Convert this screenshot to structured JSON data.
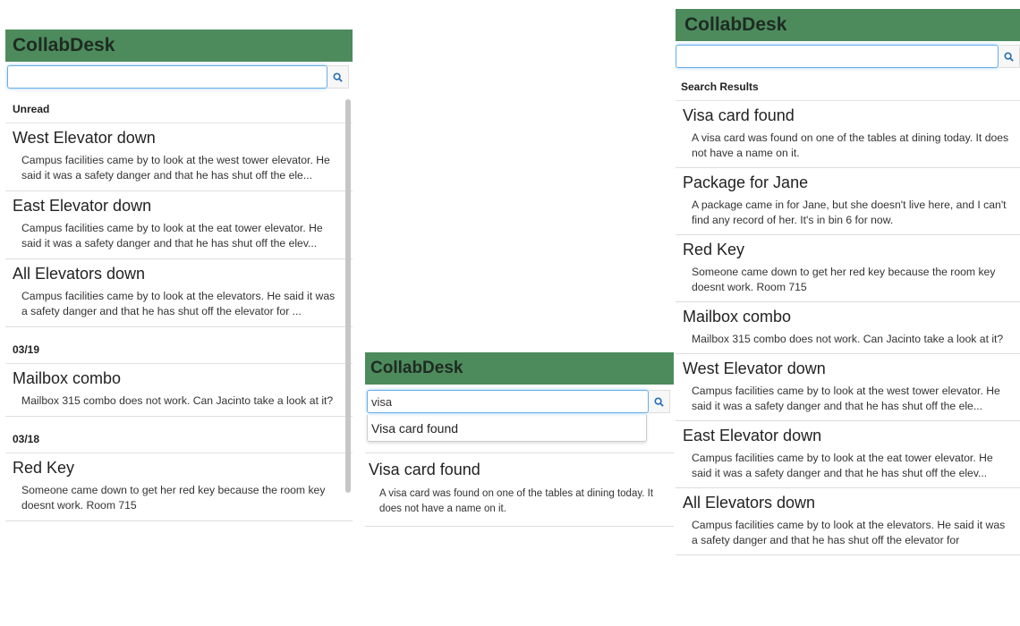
{
  "app": {
    "title": "CollabDesk",
    "header_color": "#4d8b5d"
  },
  "panel_1": {
    "search": {
      "value": "",
      "placeholder": ""
    },
    "sections": [
      {
        "heading": "Unread",
        "items": [
          {
            "title": "West Elevator down",
            "body": "Campus facilities came by to look at the west tower elevator. He said it was a safety danger and that he has shut off the ele..."
          },
          {
            "title": "East Elevator down",
            "body": "Campus facilities came by to look at the eat tower elevator. He said it was a safety danger and that he has shut off the elev..."
          },
          {
            "title": "All Elevators down",
            "body": "Campus facilities came by to look at the elevators. He said it was a safety danger and that he has shut off the elevator for ..."
          }
        ]
      },
      {
        "heading": "03/19",
        "items": [
          {
            "title": "Mailbox combo",
            "body": "Mailbox 315 combo does not work. Can Jacinto take a look at it?"
          }
        ]
      },
      {
        "heading": "03/18",
        "items": [
          {
            "title": "Red Key",
            "body": "Someone came down to get her red key because the room key doesnt work. Room 715"
          }
        ]
      }
    ]
  },
  "panel_2": {
    "search": {
      "value": "visa"
    },
    "suggestion": "Visa card found",
    "result": {
      "title": "Visa card found",
      "body": "A visa card was found on one of the tables at dining today. It does not have a name on it."
    }
  },
  "panel_3": {
    "search": {
      "value": ""
    },
    "heading": "Search Results",
    "items": [
      {
        "title": "Visa card found",
        "body": "A visa card was found on one of the tables at dining today. It does not have a name on it."
      },
      {
        "title": "Package for Jane",
        "body": "A package came in for Jane, but she doesn't live here, and I can't find any record of her. It's in bin 6 for now."
      },
      {
        "title": "Red Key",
        "body": "Someone came down to get her red key because the room key doesnt work. Room 715"
      },
      {
        "title": "Mailbox combo",
        "body": "Mailbox 315 combo does not work. Can Jacinto take a look at it?"
      },
      {
        "title": "West Elevator down",
        "body": "Campus facilities came by to look at the west tower elevator. He said it was a safety danger and that he has shut off the ele..."
      },
      {
        "title": "East Elevator down",
        "body": "Campus facilities came by to look at the eat tower elevator. He said it was a safety danger and that he has shut off the elev..."
      },
      {
        "title": "All Elevators down",
        "body": "Campus facilities came by to look at the elevators. He said it was a safety danger and that he has shut off the elevator for"
      }
    ]
  }
}
